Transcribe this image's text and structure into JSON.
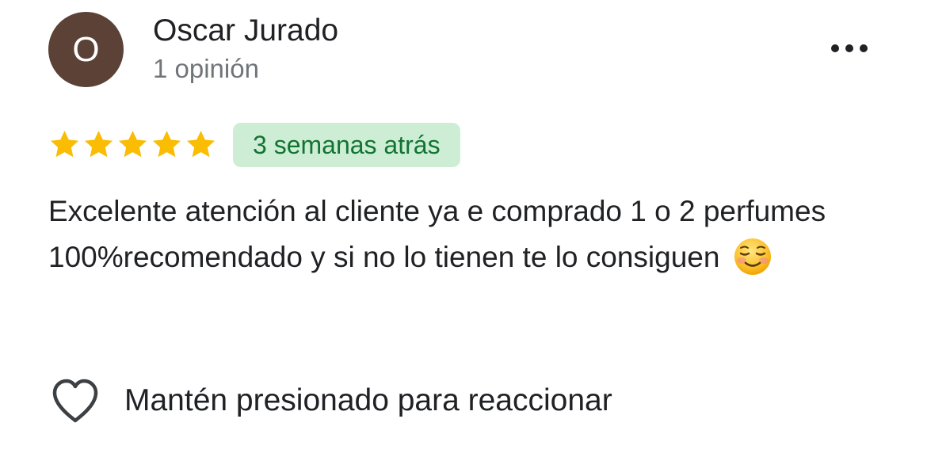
{
  "reviewer": {
    "initial": "O",
    "name": "Oscar Jurado",
    "reviews_count": "1 opinión",
    "avatar_color": "#5b4136"
  },
  "more_menu": {
    "icon": "more-horiz-icon"
  },
  "rating": {
    "stars": 5,
    "max": 5,
    "star_color": "#fbbc04"
  },
  "date_badge": {
    "text": "3 semanas atrás",
    "bg_color": "#cdeed5",
    "text_color": "#137333"
  },
  "review": {
    "text": "Excelente atención al cliente ya e comprado 1 o 2 perfumes 100%recomendado y si no lo tienen te lo consiguen",
    "emoji": "☺️"
  },
  "reaction": {
    "icon": "heart-outline-icon",
    "label": "Mantén presionado para reaccionar"
  }
}
